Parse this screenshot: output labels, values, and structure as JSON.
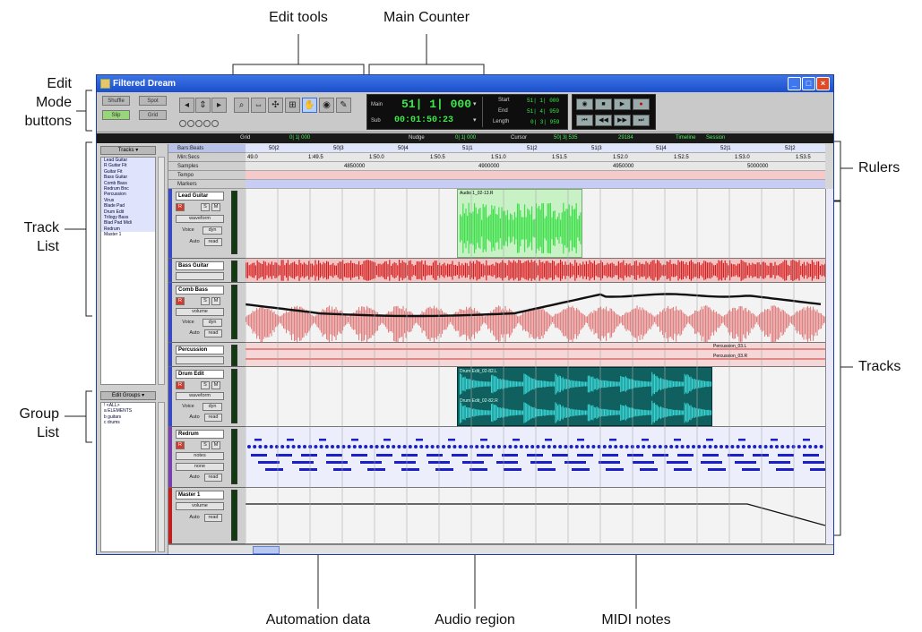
{
  "callouts": {
    "edit_tools": "Edit tools",
    "main_counter": "Main Counter",
    "edit_mode_1": "Edit",
    "edit_mode_2": "Mode",
    "edit_mode_3": "buttons",
    "track_list_1": "Track",
    "track_list_2": "List",
    "group_list_1": "Group",
    "group_list_2": "List",
    "rulers": "Rulers",
    "tracks": "Tracks",
    "automation": "Automation data",
    "audio_region": "Audio region",
    "midi_notes": "MIDI notes"
  },
  "window": {
    "title": "Filtered Dream"
  },
  "edit_modes": {
    "shuffle": "Shuffle",
    "spot": "Spot",
    "slip": "Slip",
    "grid": "Grid"
  },
  "counter": {
    "main_label": "Main",
    "sub_label": "Sub",
    "main_value": "51| 1| 000",
    "sub_value": "00:01:50:23",
    "start_label": "Start",
    "end_label": "End",
    "length_label": "Length",
    "start": "51| 1| 000",
    "end": "51| 4| 959",
    "length": "0| 3| 959"
  },
  "statusbar": {
    "grid_label": "Grid",
    "grid_value": "0| 1| 000",
    "nudge_label": "Nudge",
    "nudge_value": "0| 1| 000",
    "cursor_label": "Cursor",
    "cursor_value": "50| 3| 535",
    "cursor_sample": "29184",
    "timeline": "Timeline",
    "session": "Session"
  },
  "track_list": {
    "title": "Tracks",
    "items": [
      "Lead Guitar",
      "R Guitar Fit",
      "Guitar Fit",
      "Bass Guitar",
      "Comb Bass",
      "Redrum Bnc",
      "Percussion",
      "Virus",
      "Blade Pad",
      "Drum Edit",
      "Trilogy Bass",
      "Blad Pad Midi",
      "Redrum",
      "Master 1"
    ]
  },
  "group_list": {
    "title": "Edit Groups",
    "items": [
      "!  <ALL>",
      "a  ELEMENTS",
      "b  guitars",
      "c  drums"
    ]
  },
  "ruler_labels": [
    "Bars:Beats",
    "Min:Secs",
    "Samples",
    "Tempo",
    "Markers"
  ],
  "bars": [
    "50|2",
    "50|3",
    "50|4",
    "51|1",
    "51|2",
    "51|3",
    "51|4",
    "52|1",
    "52|2"
  ],
  "minsecs": [
    "49.0",
    "1:49.5",
    "1:50.0",
    "1:50.5",
    "1:51.0",
    "1:51.5",
    "1:52.0",
    "1:52.5",
    "1:53.0",
    "1:53.5"
  ],
  "samples": [
    "4850000",
    "4900000",
    "4950000",
    "5000000"
  ],
  "tracks": [
    {
      "name": "Lead Guitar",
      "view": "waveform",
      "color": "#3a49c6"
    },
    {
      "name": "Bass Guitar",
      "view": "",
      "color": "#3a49c6"
    },
    {
      "name": "Comb Bass",
      "view": "volume",
      "color": "#3a49c6"
    },
    {
      "name": "Percussion",
      "view": "",
      "color": "#3a49c6"
    },
    {
      "name": "Drum Edit",
      "view": "waveform",
      "color": "#3a49c6"
    },
    {
      "name": "Redrum",
      "view": "notes",
      "color": "#7a3fb0"
    },
    {
      "name": "Master 1",
      "view": "volume",
      "color": "#c22020"
    }
  ],
  "track_controls": {
    "rec": "R",
    "solo": "S",
    "mute": "M",
    "voice": "Voice",
    "dyn": "dyn",
    "auto": "Auto",
    "read": "read",
    "none": "none"
  },
  "regions": {
    "audio1": "Audio 1_02-13.R",
    "perc1": "Percussion_03.L",
    "perc2": "Percussion_03.R",
    "drum_l": "Drum Edit_02-82.L",
    "drum_r": "Drum Edit_02-82.R"
  },
  "colors": {
    "audio_green": "#3ee04a",
    "bass_red": "#d42020",
    "comb_red": "#e08080",
    "drum_cyan": "#3ad7d7",
    "midi_blue": "#1a1fc8",
    "titlebar": "#2a5fd8"
  }
}
